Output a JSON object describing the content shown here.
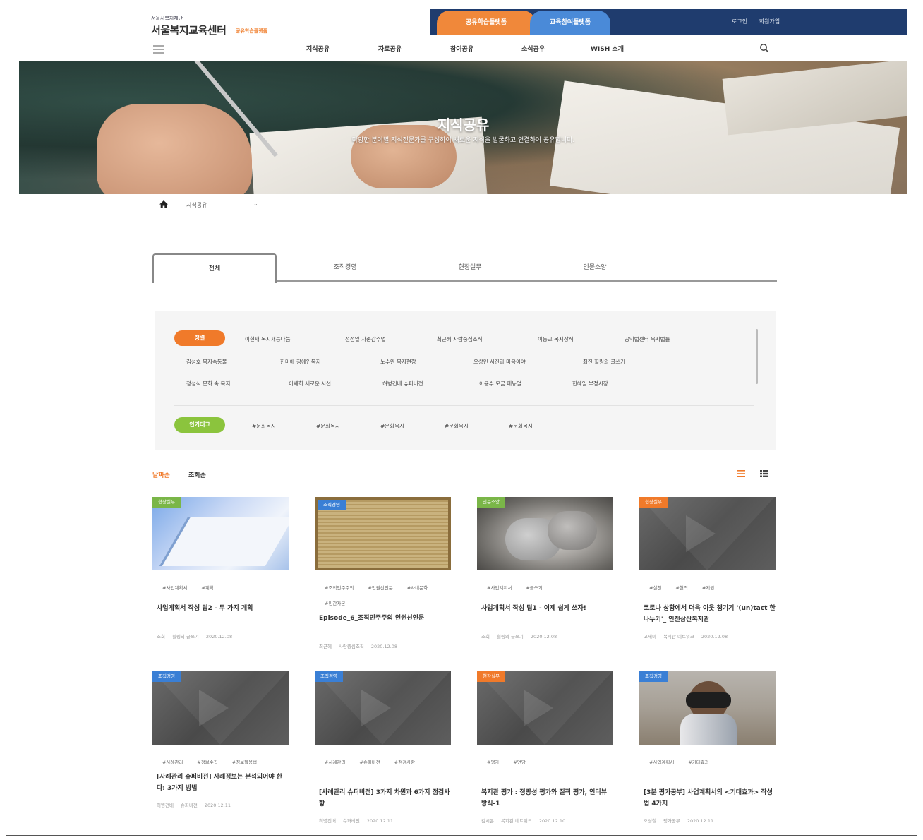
{
  "header": {
    "logo_small": "서울시복지재단",
    "logo_main": "서울복지교육센터",
    "logo_sub": "공유학습플랫폼",
    "tab_orange": "공유학습플랫폼",
    "tab_blue": "교육참여플랫폼",
    "login": "로그인",
    "join": "회원가입",
    "nav": [
      "지식공유",
      "자료공유",
      "참여공유",
      "소식공유",
      "WISH 소개"
    ]
  },
  "hero": {
    "title": "지식공유",
    "description": "다양한 분야별 지식전문가를 구성하여 새로운 지식을 발굴하고 연결하여 공유합니다."
  },
  "breadcrumb": {
    "current": "지식공유",
    "chevron": "⌄"
  },
  "tabs": [
    "전체",
    "조직경영",
    "현장실무",
    "인문소양"
  ],
  "filter": {
    "region_label": "정렬",
    "keyword_label": "인기태그",
    "people_rows": [
      [
        "이현재 복지재능나눔",
        "전성일 자존감수업",
        "최근혜 사람중심조직",
        "이동교 복지상식",
        "공익법센터 복지법률"
      ],
      [
        "김성호 복지속동물",
        "한미애 장애인복지",
        "노수완 복지현장",
        "오상민 사진과 마음이야",
        "최진 힐링의 글쓰기"
      ],
      [
        "정성식 문화 속 복지",
        "이세희 새로운 시선",
        "허병건배 슈퍼비전",
        "이용수 모금 매뉴얼",
        "한혜일 부정시장"
      ]
    ],
    "keywords": [
      "#문화복지",
      "#문화복지",
      "#문화복지",
      "#문화복지",
      "#문화복지"
    ]
  },
  "sort": {
    "newest": "날짜순",
    "views": "조회순"
  },
  "cards": [
    {
      "badge": "현장실무",
      "badge_color": "green",
      "tags": [
        "#사업계획서",
        "#계획"
      ],
      "title": "사업계획서 작성 팁2 - 두 가지 계획",
      "meta": [
        "조회",
        "힐링의 글쓰기",
        "2020.12.08"
      ]
    },
    {
      "badge": "조직경영",
      "badge_color": "blue",
      "tags": [
        "#조직인주주의",
        "#인권선언문",
        "#사내문화",
        "#인간자본"
      ],
      "title": "Episode_6_조직민주주의 인권선언문",
      "meta": [
        "최근혜",
        "사람중심조직",
        "2020.12.08"
      ]
    },
    {
      "badge": "인문소양",
      "badge_color": "green",
      "tags": [
        "#사업계획서",
        "#글쓰기"
      ],
      "title": "사업계획서 작성 팁1 - 이제 쉽게 쓰자!",
      "meta": [
        "조회",
        "힐링의 글쓰기",
        "2020.12.08"
      ]
    },
    {
      "badge": "현장실무",
      "badge_color": "orange",
      "tags": [
        "#실천",
        "#현력",
        "#지원"
      ],
      "title": "코로나 상황에서 더욱 이웃 챙기기 '(un)tact 한 나누기'_ 인천삼산복지관",
      "meta": [
        "고세미",
        "복지관 네트워크",
        "2020.12.08"
      ]
    },
    {
      "badge": "조직경영",
      "badge_color": "blue",
      "tags": [
        "#사례관리",
        "#정보수집",
        "#정보활용법"
      ],
      "title": "[사례관리 슈퍼비전] 사례정보는 분석되어야 한다: 3가지 방법",
      "meta": [
        "허병건배",
        "슈퍼비전",
        "2020.12.11"
      ]
    },
    {
      "badge": "조직경영",
      "badge_color": "blue",
      "tags": [
        "#사례관리",
        "#슈퍼비전",
        "#점검사항"
      ],
      "title": "[사례관리 슈퍼비전] 3가지 차원과 6가지 점검사항",
      "meta": [
        "허병건배",
        "슈퍼비전",
        "2020.12.11"
      ]
    },
    {
      "badge": "현장실무",
      "badge_color": "orange",
      "tags": [
        "#평가",
        "#면담"
      ],
      "title": "복지관 평가 : 정량성 평가와 질적 평가, 인터뷰 방식-1",
      "meta": [
        "김시은",
        "복지관 네트워크",
        "2020.12.10"
      ]
    },
    {
      "badge": "조직경영",
      "badge_color": "blue",
      "tags": [
        "#사업계획서",
        "#기대효과"
      ],
      "title": "[3분 평가공부] 사업계획서의 <기대효과> 작성법 4가지",
      "meta": [
        "오성철",
        "평가공부",
        "2020.12.11"
      ]
    }
  ],
  "colors": {
    "navy": "#1f3c6e",
    "orange": "#f07a2a",
    "blue": "#3a7fd5",
    "green": "#7ab648"
  }
}
